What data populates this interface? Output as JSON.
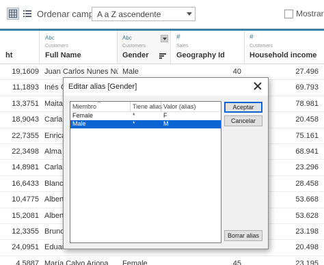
{
  "toolbar": {
    "sort_label": "Ordenar campos",
    "sort_value": "A a Z ascendente",
    "show_label": "Mostrar a"
  },
  "columns": [
    {
      "type": "",
      "source": "",
      "name": "ht"
    },
    {
      "type": "Abc",
      "source": "Customers",
      "name": "Full Name"
    },
    {
      "type": "Abc",
      "source": "Customers",
      "name": "Gender"
    },
    {
      "type": "#",
      "source": "Sales",
      "name": "Geography Id"
    },
    {
      "type": "#",
      "source": "Customers",
      "name": "Household income"
    }
  ],
  "rows": [
    [
      "19,1609",
      "Juan Carlos Nunes Nú…",
      "Male",
      "40",
      "27.496"
    ],
    [
      "11,1893",
      "Inés G",
      "",
      "",
      "69.793"
    ],
    [
      "13,3751",
      "Maita",
      "",
      "",
      "78.981"
    ],
    [
      "18,9043",
      "Carla",
      "",
      "",
      "20.458"
    ],
    [
      "22,7355",
      "Enrica",
      "",
      "",
      "75.161"
    ],
    [
      "22,3498",
      "Alma M",
      "",
      "",
      "68.941"
    ],
    [
      "14,8981",
      "Carla",
      "",
      "",
      "23.296"
    ],
    [
      "16,6433",
      "Blanca",
      "",
      "",
      "28.458"
    ],
    [
      "10,4775",
      "Albert",
      "",
      "",
      "53.668"
    ],
    [
      "15,2081",
      "Albert",
      "",
      "",
      "53.628"
    ],
    [
      "12,3355",
      "Bruno",
      "",
      "",
      "23.198"
    ],
    [
      "24,0951",
      "Eduar",
      "",
      "",
      "20.498"
    ],
    [
      "4,5887",
      "María Calvo Arjona",
      "Female",
      "45",
      "23.195"
    ]
  ],
  "dialog": {
    "title": "Editar alias [Gender]",
    "headers": [
      "Miembro",
      "Tiene alias",
      "Valor (alias)"
    ],
    "members": [
      {
        "member": "Female",
        "has_alias": "*",
        "alias": "F",
        "selected": false
      },
      {
        "member": "Male",
        "has_alias": "*",
        "alias": "M",
        "selected": true
      }
    ],
    "accept_label": "Aceptar",
    "cancel_label": "Cancelar",
    "clear_label": "Borrar alias"
  }
}
